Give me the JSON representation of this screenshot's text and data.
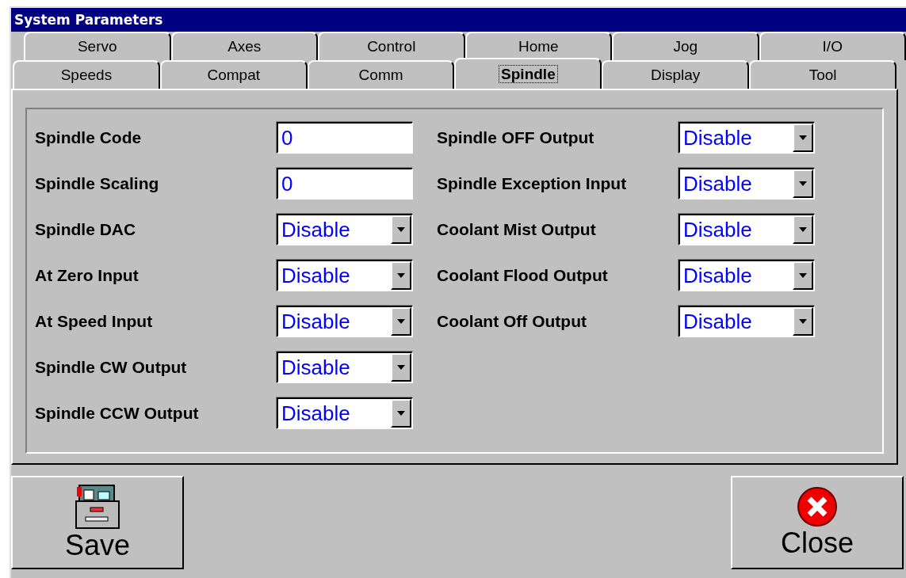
{
  "window": {
    "title": "System Parameters"
  },
  "tab_rows": [
    [
      {
        "label": "Servo",
        "selected": false
      },
      {
        "label": "Axes",
        "selected": false
      },
      {
        "label": "Control",
        "selected": false
      },
      {
        "label": "Home",
        "selected": false
      },
      {
        "label": "Jog",
        "selected": false
      },
      {
        "label": "I/O",
        "selected": false
      }
    ],
    [
      {
        "label": "Speeds",
        "selected": false
      },
      {
        "label": "Compat",
        "selected": false
      },
      {
        "label": "Comm",
        "selected": false
      },
      {
        "label": "Spindle",
        "selected": true
      },
      {
        "label": "Display",
        "selected": false
      },
      {
        "label": "Tool",
        "selected": false
      }
    ]
  ],
  "columns": [
    [
      {
        "label": "Spindle Code",
        "kind": "text",
        "value": "0"
      },
      {
        "label": "Spindle Scaling",
        "kind": "text",
        "value": "0"
      },
      {
        "label": "Spindle DAC",
        "kind": "dropdown",
        "value": "Disable"
      },
      {
        "label": "At Zero Input",
        "kind": "dropdown",
        "value": "Disable"
      },
      {
        "label": "At Speed Input",
        "kind": "dropdown",
        "value": "Disable"
      },
      {
        "label": "Spindle CW Output",
        "kind": "dropdown",
        "value": "Disable"
      },
      {
        "label": "Spindle CCW Output",
        "kind": "dropdown",
        "value": "Disable"
      }
    ],
    [
      {
        "label": "Spindle OFF Output",
        "kind": "dropdown",
        "value": "Disable"
      },
      {
        "label": "Spindle Exception Input",
        "kind": "dropdown",
        "value": "Disable"
      },
      {
        "label": "Coolant Mist Output",
        "kind": "dropdown",
        "value": "Disable"
      },
      {
        "label": "Coolant Flood Output",
        "kind": "dropdown",
        "value": "Disable"
      },
      {
        "label": "Coolant Off Output",
        "kind": "dropdown",
        "value": "Disable"
      }
    ]
  ],
  "buttons": [
    {
      "label": "Save",
      "kind": "save"
    },
    {
      "label": "Close",
      "kind": "close"
    }
  ]
}
